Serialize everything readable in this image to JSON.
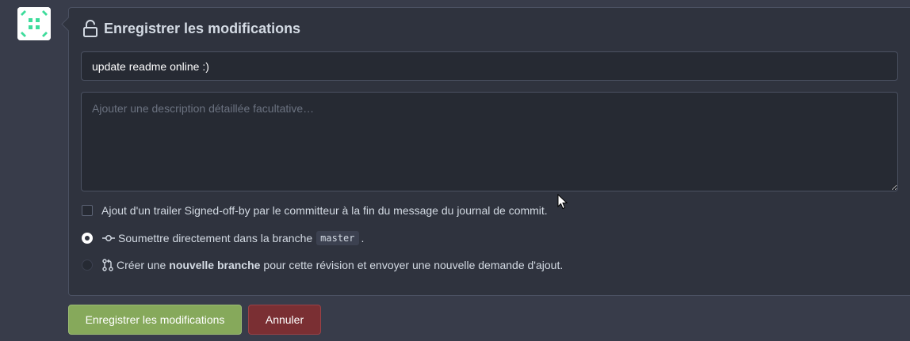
{
  "header": {
    "title": "Enregistrer les modifications",
    "icon": "unlock-icon"
  },
  "commit": {
    "summary_value": "update readme online :)",
    "description_placeholder": "Ajouter une description détaillée facultative…"
  },
  "options": {
    "signoff_label": "Ajout d'un trailer Signed-off-by par le committeur à la fin du message du journal de commit.",
    "direct_commit_label": "Soumettre directement dans la branche",
    "branch_name": "master",
    "direct_commit_suffix": ".",
    "new_branch_prefix": "Créer une",
    "new_branch_bold": "nouvelle branche",
    "new_branch_suffix": "pour cette révision et envoyer une nouvelle demande d'ajout."
  },
  "buttons": {
    "submit_label": "Enregistrer les modifications",
    "cancel_label": "Annuler"
  },
  "colors": {
    "background": "#383c4a",
    "panel": "#2f333e",
    "input": "#262a33",
    "primary": "#86a95b",
    "danger": "#7a2f33",
    "avatar_accent": "#3ddc9b"
  }
}
